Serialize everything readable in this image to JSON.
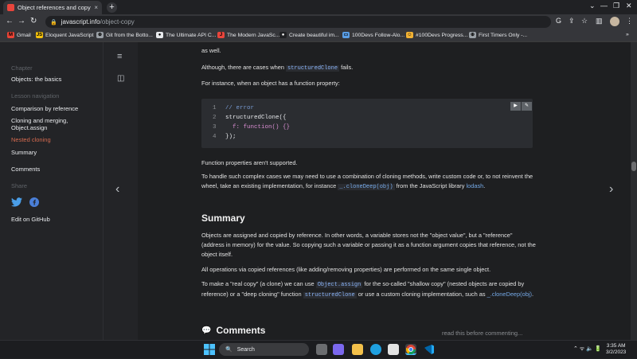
{
  "browser": {
    "tab_title": "Object references and copying",
    "tab_close": "×",
    "new_tab": "+",
    "url_host": "javascript.info",
    "url_path": "/object-copy",
    "bookmarks": [
      {
        "label": "Gmail",
        "color": "#ea4335",
        "glyph": "M"
      },
      {
        "label": "Eloquent JavaScript",
        "color": "#f4c20d",
        "glyph": "JS"
      },
      {
        "label": "Git from the Botto...",
        "color": "#9aa0a6",
        "glyph": "⊕"
      },
      {
        "label": "The Ultimate API C...",
        "color": "#e8eaed",
        "glyph": "●"
      },
      {
        "label": "The Modern JavaSc...",
        "color": "#e8453c",
        "glyph": "J"
      },
      {
        "label": "Create beautiful im...",
        "color": "#202124",
        "glyph": "●"
      },
      {
        "label": "100Devs Follow-Alo...",
        "color": "#5a9ee6",
        "glyph": "▭"
      },
      {
        "label": "#100Devs Progress...",
        "color": "#f2b233",
        "glyph": "☺"
      },
      {
        "label": "First Timers Only -...",
        "color": "#9aa0a6",
        "glyph": "⊕"
      }
    ],
    "more_bookmarks": "»"
  },
  "sidebar": {
    "chapter_label": "Chapter",
    "chapter_title": "Objects: the basics",
    "lesson_nav_label": "Lesson navigation",
    "items": [
      "Comparison by reference",
      "Cloning and merging, Object.assign",
      "Nested cloning",
      "Summary",
      "Comments"
    ],
    "active_index": 2,
    "share_label": "Share",
    "edit_label": "Edit on GitHub"
  },
  "content": {
    "top_line_suffix": "as well.",
    "p_structured_fails_pre": "Although, there are cases when",
    "structured_clone": "structuredClone",
    "p_structured_fails_post": "fails.",
    "p_for_instance": "For instance, when an object has a function property:",
    "code_lines": [
      {
        "n": "1",
        "text": "// error"
      },
      {
        "n": "2",
        "text": "structuredClone({"
      },
      {
        "n": "3",
        "text": "  f: function() {}"
      },
      {
        "n": "4",
        "text": "});"
      }
    ],
    "p_func_unsupported": "Function properties aren't supported.",
    "p_handle_pre": "To handle such complex cases we may need to use a combination of cloning methods, write custom code or, to not reinvent the wheel, take an existing implementation, for instance",
    "lodash_clone": "_.cloneDeep(obj)",
    "p_handle_mid": "from the JavaScript library",
    "lodash": "lodash",
    "p_handle_end": ".",
    "summary_heading": "Summary",
    "p_summary1": "Objects are assigned and copied by reference. In other words, a variable stores not the \"object value\", but a \"reference\" (address in memory) for the value. So copying such a variable or passing it as a function argument copies that reference, not the object itself.",
    "p_summary2": "All operations via copied references (like adding/removing properties) are performed on the same single object.",
    "p_summary3_pre": "To make a \"real copy\" (a clone) we can use",
    "object_assign": "Object.assign",
    "p_summary3_mid": "for the so-called \"shallow copy\" (nested objects are copied by reference) or a \"deep cloning\" function",
    "p_summary3_mid2": "or use a custom cloning implementation, such as",
    "p_summary3_end": ".",
    "comments_heading": "Comments",
    "read_before": "read this before commenting..."
  },
  "taskbar": {
    "search_label": "Search",
    "time": "3:35 AM",
    "date": "3/2/2023"
  }
}
